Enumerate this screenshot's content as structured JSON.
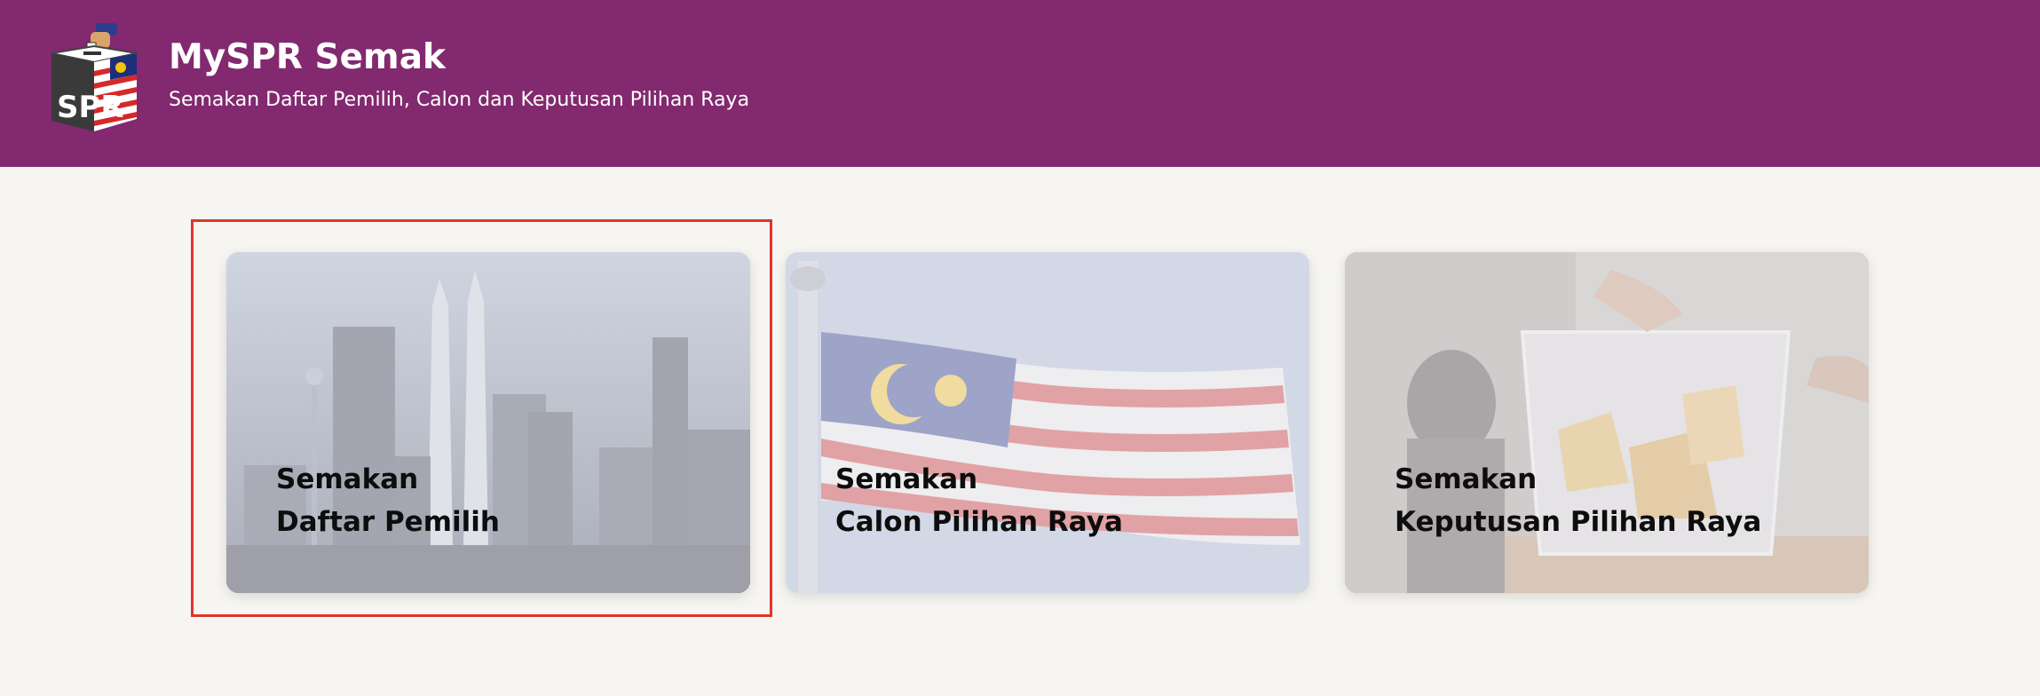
{
  "header": {
    "title": "MySPR Semak",
    "subtitle": "Semakan Daftar Pemilih, Calon dan Keputusan Pilihan Raya",
    "background": "#82296f",
    "logo_text": "SPR"
  },
  "cards": [
    {
      "line1": "Semakan",
      "line2": "Daftar Pemilih",
      "image": "city-skyline",
      "highlighted": true
    },
    {
      "line1": "Semakan",
      "line2": "Calon Pilihan Raya",
      "image": "malaysia-flag",
      "highlighted": false
    },
    {
      "line1": "Semakan",
      "line2": "Keputusan Pilihan Raya",
      "image": "ballot-box",
      "highlighted": false
    }
  ],
  "colors": {
    "page_background": "#f6f5f1",
    "highlight_border": "#e0362a",
    "card_text": "#0d0d0d"
  }
}
